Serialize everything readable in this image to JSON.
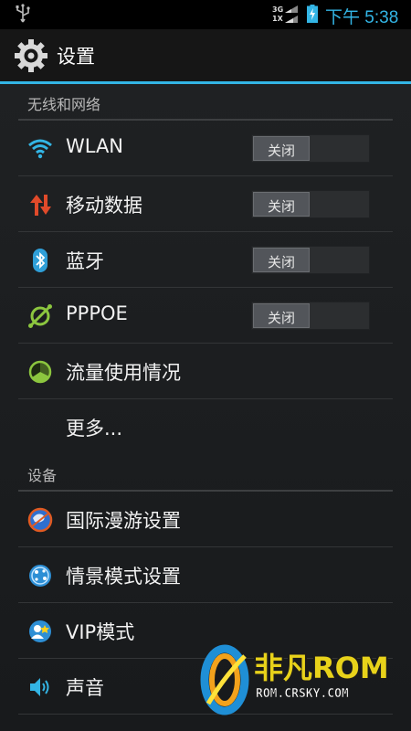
{
  "status_bar": {
    "network_top": "3G",
    "network_bottom": "1X",
    "time": "下午 5:38"
  },
  "action_bar": {
    "icon": "settings-gear-icon",
    "title": "设置"
  },
  "sections": {
    "wireless": "无线和网络",
    "device": "设备"
  },
  "items": {
    "wlan": {
      "label": "WLAN",
      "icon": "wifi-icon",
      "toggle": "关闭"
    },
    "mobile_data": {
      "label": "移动数据",
      "icon": "mobile-data-icon",
      "toggle": "关闭"
    },
    "bluetooth": {
      "label": "蓝牙",
      "icon": "bluetooth-icon",
      "toggle": "关闭"
    },
    "pppoe": {
      "label": "PPPOE",
      "icon": "pppoe-icon",
      "toggle": "关闭"
    },
    "data_usage": {
      "label": "流量使用情况",
      "icon": "data-usage-icon"
    },
    "more": {
      "label": "更多..."
    },
    "roaming": {
      "label": "国际漫游设置",
      "icon": "globe-roaming-icon"
    },
    "profiles": {
      "label": "情景模式设置",
      "icon": "profiles-icon"
    },
    "vip": {
      "label": "VIP模式",
      "icon": "vip-icon"
    },
    "sound": {
      "label": "声音",
      "icon": "speaker-icon"
    }
  },
  "watermark": {
    "brand": "非凡ROM",
    "url": "ROM.CRSKY.COM"
  },
  "colors": {
    "accent": "#33b5e5",
    "background": "#1c1e20",
    "mobile_data_red": "#e04a2a",
    "pppoe_green": "#8cc63f",
    "watermark_yellow": "#e8d21a"
  }
}
